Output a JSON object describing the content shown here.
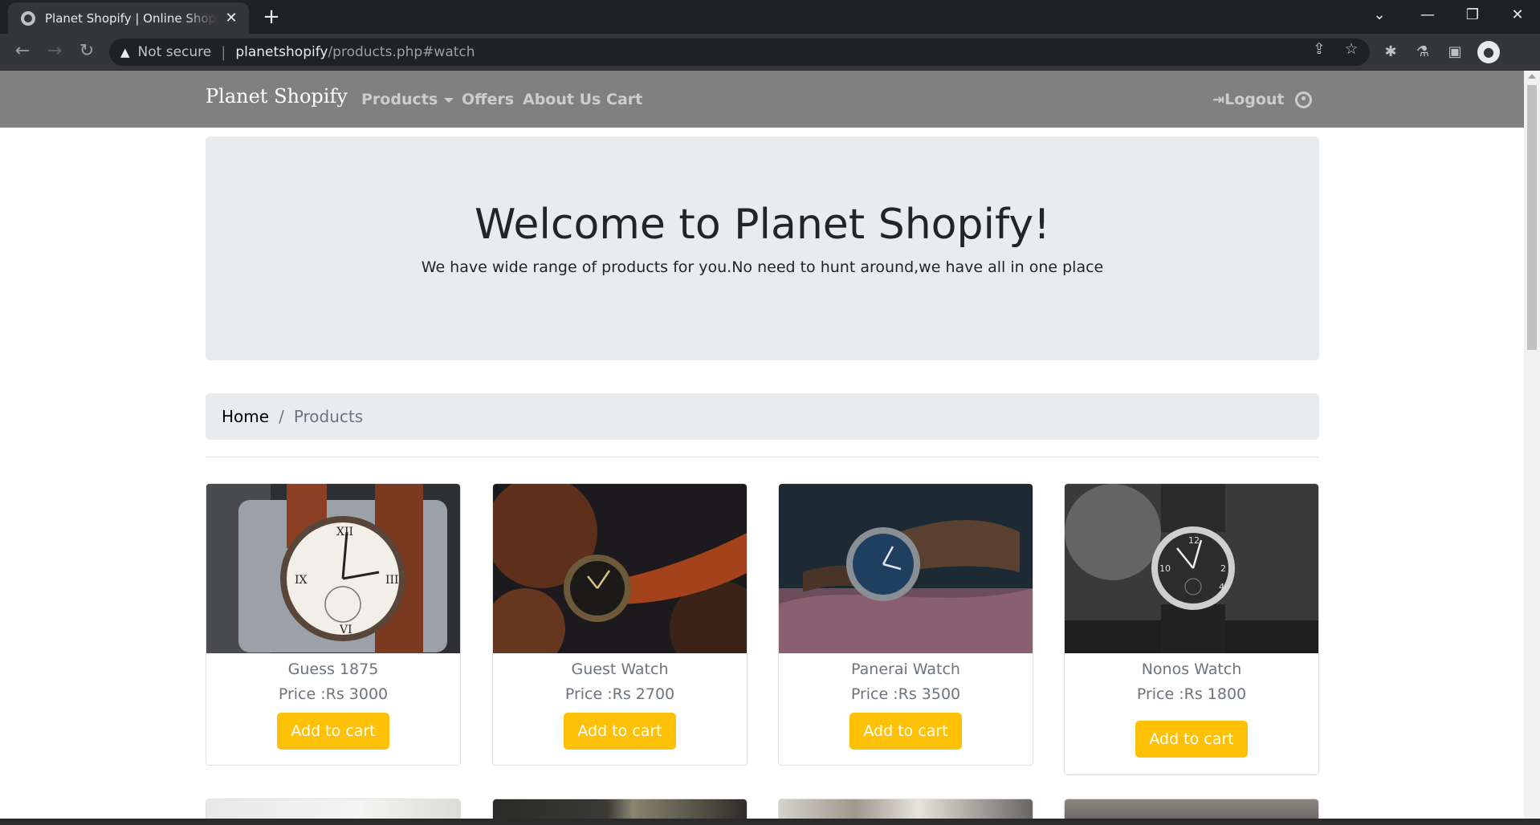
{
  "browser": {
    "tab_title": "Planet Shopify | Online Shopping",
    "security_label": "Not secure",
    "url_host": "planetshopify",
    "url_path": "/products.php#watch"
  },
  "site": {
    "brand": "Planet Shopify",
    "nav": {
      "products": "Products",
      "offers": "Offers",
      "about": "About Us",
      "cart": "Cart",
      "logout": "Logout"
    },
    "hero": {
      "title": "Welcome to Planet Shopify!",
      "subtitle": "We have wide range of products for you.No need to hunt around,we have all in one place"
    },
    "breadcrumb": {
      "home": "Home",
      "separator": "/",
      "current": "Products"
    },
    "products": [
      {
        "name": "Guess 1875",
        "price": "Price :Rs 3000",
        "button": "Add to cart"
      },
      {
        "name": "Guest Watch",
        "price": "Price :Rs 2700",
        "button": "Add to cart"
      },
      {
        "name": "Panerai Watch",
        "price": "Price :Rs 3500",
        "button": "Add to cart"
      },
      {
        "name": "Nonos Watch",
        "price": "Price :Rs 1800",
        "button": "Add to cart"
      }
    ]
  },
  "colors": {
    "navbar": "#808080",
    "jumbotron": "#e9ecef",
    "button": "#ffc107"
  }
}
